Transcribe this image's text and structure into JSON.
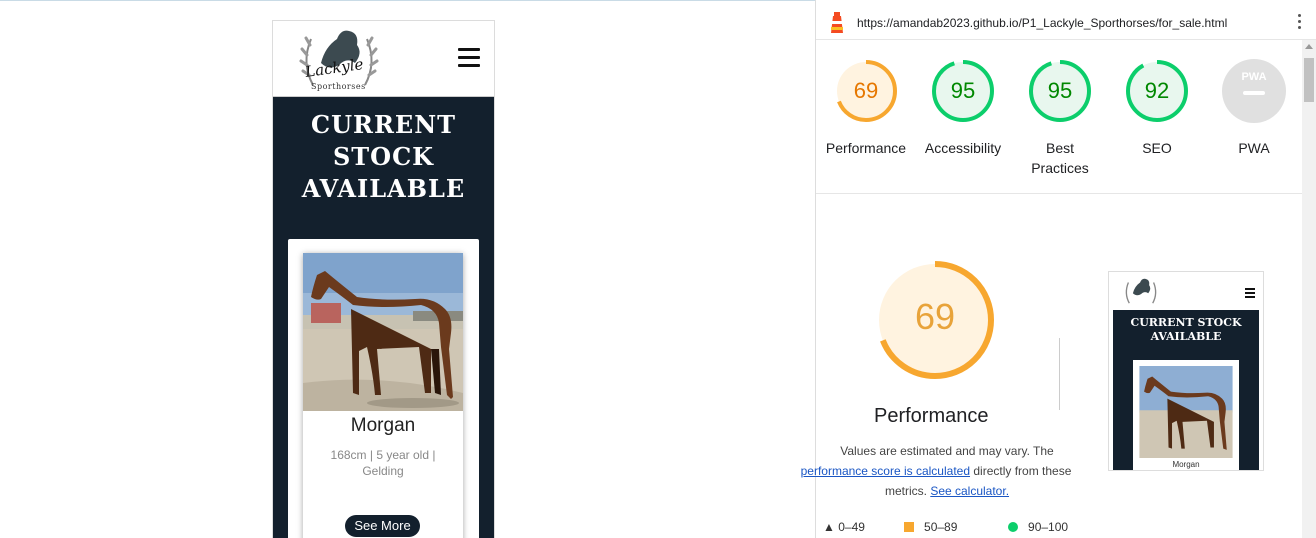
{
  "mobile_site": {
    "logo_text": "Lackyle",
    "logo_sub": "Sporthorses",
    "hero_title_lines": [
      "CURRENT",
      "STOCK",
      "AVAILABLE"
    ],
    "card": {
      "name": "Morgan",
      "details": "168cm | 5 year old | Gelding",
      "button": "See More"
    }
  },
  "lighthouse": {
    "url": "https://amandab2023.github.io/P1_Lackyle_Sporthorses/for_sale.html",
    "scores": [
      {
        "label": "Performance",
        "score": 69,
        "color": "#e67700",
        "ring": "#f7a72f",
        "bg": "#fff3e0"
      },
      {
        "label": "Accessibility",
        "score": 95,
        "color": "#008800",
        "ring": "#0cce6b",
        "bg": "#e8f7ee"
      },
      {
        "label": "Best Practices",
        "score": 95,
        "color": "#008800",
        "ring": "#0cce6b",
        "bg": "#e8f7ee"
      },
      {
        "label": "SEO",
        "score": 92,
        "color": "#008800",
        "ring": "#0cce6b",
        "bg": "#e8f7ee"
      },
      {
        "label": "PWA",
        "score": null,
        "badge": "PWA"
      }
    ],
    "detail": {
      "score": "69",
      "title": "Performance",
      "desc_prefix": "Values are estimated and may vary. The",
      "desc_link1": "performance score is calculated",
      "desc_mid": "directly from these metrics.",
      "desc_link2": "See calculator."
    },
    "legend": {
      "fail": "0–49",
      "average": "50–89",
      "pass": "90–100"
    },
    "thumbnail": {
      "title": "CURRENT STOCK AVAILABLE",
      "name": "Morgan"
    }
  }
}
